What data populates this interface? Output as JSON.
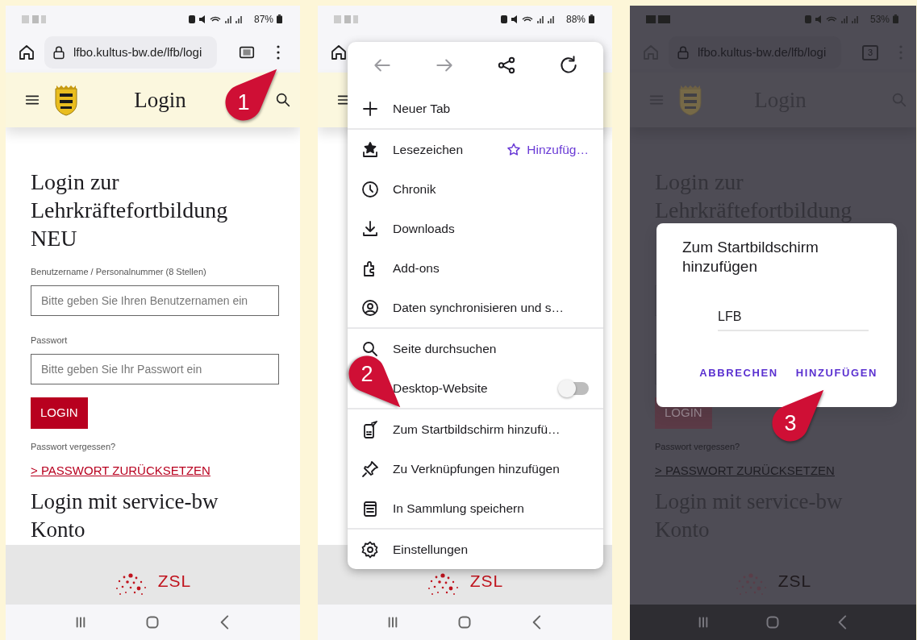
{
  "phones": [
    {
      "dimmed": false,
      "battery": "87%",
      "toolbar": {
        "url": "lfbo.kultus-bw.de/lfb/logi"
      },
      "header_title": "Login",
      "page": {
        "heading": "Login zur Lehrkräftefortbildung NEU",
        "username_label": "Benutzername / Personalnummer (8 Stellen)",
        "username_placeholder": "Bitte geben Sie Ihren Benutzernamen ein",
        "password_label": "Passwort",
        "password_placeholder": "Bitte geben Sie Ihr Passwort ein",
        "login_button": "LOGIN",
        "forgot": "Passwort vergessen?",
        "reset_link": "> PASSWORT ZURÜCKSETZEN",
        "second_heading": "Login mit service-bw Konto"
      },
      "footer_logo": "ZSL",
      "marker": {
        "number": "1"
      }
    },
    {
      "dimmed": false,
      "battery": "88%",
      "footer_logo": "ZSL",
      "marker": {
        "number": "2"
      },
      "menu": {
        "nav": [
          {
            "disabled": true
          },
          {
            "disabled": true
          },
          {
            "disabled": false
          },
          {
            "disabled": false
          }
        ],
        "groups": [
          [
            {
              "kind": "plain",
              "label": "Neuer Tab"
            }
          ],
          [
            {
              "kind": "action",
              "label": "Lesezeichen",
              "action": "Hinzufüg…"
            },
            {
              "kind": "plain",
              "label": "Chronik"
            },
            {
              "kind": "plain",
              "label": "Downloads"
            },
            {
              "kind": "plain",
              "label": "Add-ons"
            },
            {
              "kind": "plain",
              "label": "Daten synchronisieren und s…"
            }
          ],
          [
            {
              "kind": "plain",
              "label": "Seite durchsuchen"
            },
            {
              "kind": "toggle",
              "label": "Desktop-Website",
              "on": false
            }
          ],
          [
            {
              "kind": "plain",
              "label": "Zum Startbildschirm hinzufü…"
            },
            {
              "kind": "plain",
              "label": "Zu Verknüpfungen hinzufügen"
            },
            {
              "kind": "plain",
              "label": "In Sammlung speichern"
            }
          ],
          [
            {
              "kind": "plain",
              "label": "Einstellungen"
            }
          ]
        ]
      }
    },
    {
      "dimmed": true,
      "battery": "53%",
      "toolbar": {
        "url": "lfbo.kultus-bw.de/lfb/logi",
        "tab_count": "3"
      },
      "header_title": "Login",
      "page": {
        "heading": "Login zur Lehrkräftefortbildung",
        "login_button": "LOGIN",
        "forgot": "Passwort vergessen?",
        "reset_link": "> PASSWORT ZURÜCKSETZEN",
        "second_heading": "Login mit service-bw Konto"
      },
      "footer_logo": "ZSL",
      "marker": {
        "number": "3"
      },
      "dialog": {
        "title": "Zum Startbildschirm hinzufügen",
        "value": "LFB",
        "buttons": [
          "ABBRECHEN",
          "HINZUFÜGEN"
        ]
      }
    }
  ]
}
